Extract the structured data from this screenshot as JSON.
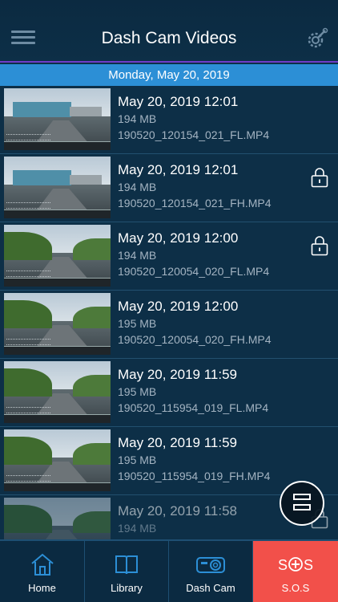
{
  "header": {
    "title": "Dash Cam Videos",
    "menu_icon": "hamburger-menu-icon",
    "settings_icon": "gear-wrench-icon"
  },
  "date_band": {
    "label": "Monday, May 20, 2019"
  },
  "videos": [
    {
      "datetime": "May 20, 2019 12:01",
      "size": "194 MB",
      "filename": "190520_120154_021_FL.MP4",
      "locked": false
    },
    {
      "datetime": "May 20, 2019 12:01",
      "size": "194 MB",
      "filename": "190520_120154_021_FH.MP4",
      "locked": true
    },
    {
      "datetime": "May 20, 2019 12:00",
      "size": "194 MB",
      "filename": "190520_120054_020_FL.MP4",
      "locked": true
    },
    {
      "datetime": "May 20, 2019 12:00",
      "size": "195 MB",
      "filename": "190520_120054_020_FH.MP4",
      "locked": false
    },
    {
      "datetime": "May 20, 2019 11:59",
      "size": "195 MB",
      "filename": "190520_115954_019_FL.MP4",
      "locked": false
    },
    {
      "datetime": "May 20, 2019 11:59",
      "size": "195 MB",
      "filename": "190520_115954_019_FH.MP4",
      "locked": false
    },
    {
      "datetime": "May 20, 2019 11:58",
      "size": "194 MB",
      "filename": "",
      "locked": true
    }
  ],
  "nav": {
    "home": "Home",
    "library": "Library",
    "dashcam": "Dash Cam",
    "sos": "S.O.S"
  },
  "colors": {
    "accent": "#2c8fd6",
    "sos": "#f2504a",
    "background": "#0d2f47",
    "divider": "#6f3cc8"
  }
}
